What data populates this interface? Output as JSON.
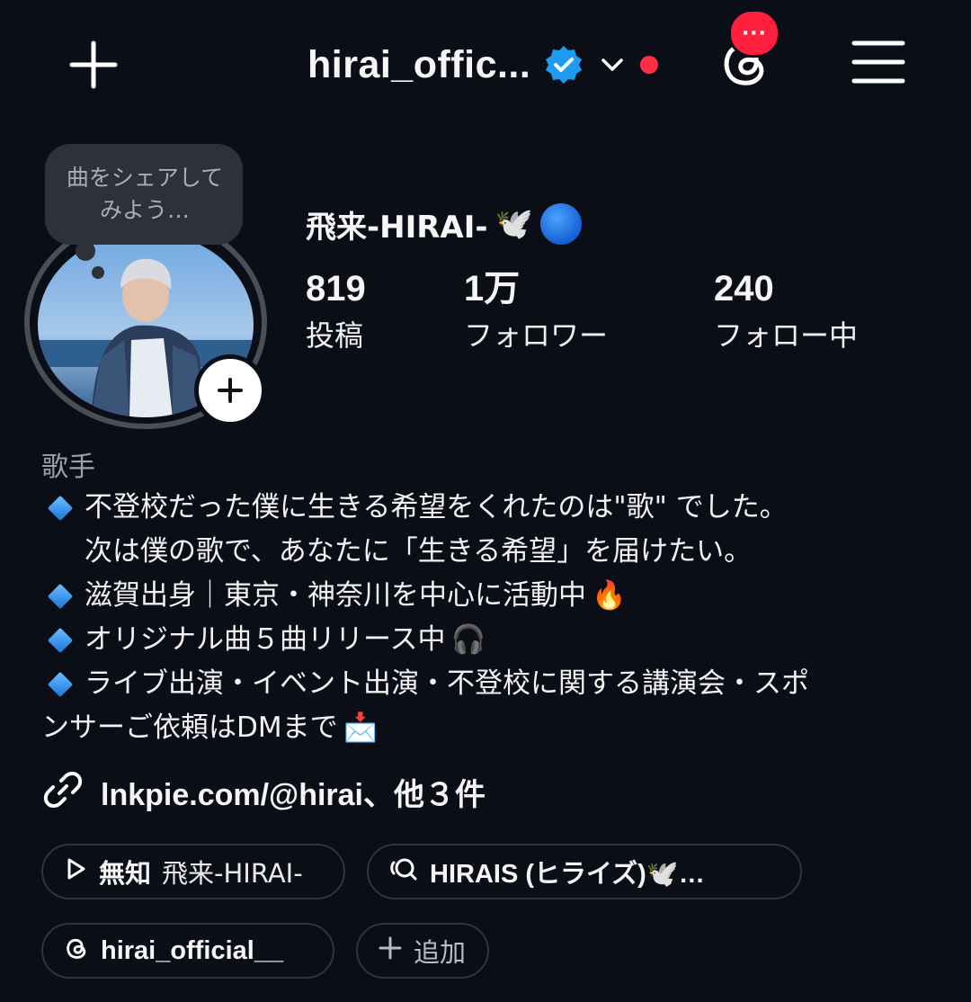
{
  "header": {
    "username": "hirai_offic...",
    "notification_badge": "···",
    "icons": {
      "create": "plus-icon",
      "verified": "verified-badge-icon",
      "switch_account": "chevron-down-icon",
      "threads": "threads-icon",
      "menu": "hamburger-menu-icon"
    },
    "colors": {
      "red_dot": "#ff2d45",
      "verified": "#1d9bf0"
    }
  },
  "profile": {
    "note": "曲をシェアしてみよう…",
    "display_name": "飛来-HIRAI-",
    "display_name_emoji": "🕊️",
    "stats": [
      {
        "value": "819",
        "label": "投稿"
      },
      {
        "value": "1万",
        "label": "フォロワー"
      },
      {
        "value": "240",
        "label": "フォロー中"
      }
    ]
  },
  "bio": {
    "category": "歌手",
    "lines": [
      "不登校だった僕に生きる希望をくれたのは\"歌\" でした。",
      "次は僕の歌で、あなたに「生きる希望」を届けたい。",
      "滋賀出身｜東京・神奈川を中心に活動中",
      "オリジナル曲５曲リリース中",
      "ライブ出演・イベント出演・不登校に関する講演会・スポ",
      "ンサーご依頼はDMまで"
    ],
    "emojis": {
      "fire": "🔥",
      "headphones": "🎧",
      "envelope": "📩"
    },
    "link": "lnkpie.com/@hirai、他３件"
  },
  "pills": {
    "music_title": "無知",
    "music_artist": "飛来-HIRAI-",
    "broadcast": "HIRAIS (ヒライズ)🕊️…",
    "threads_handle": "hirai_official__",
    "add": "追加"
  }
}
